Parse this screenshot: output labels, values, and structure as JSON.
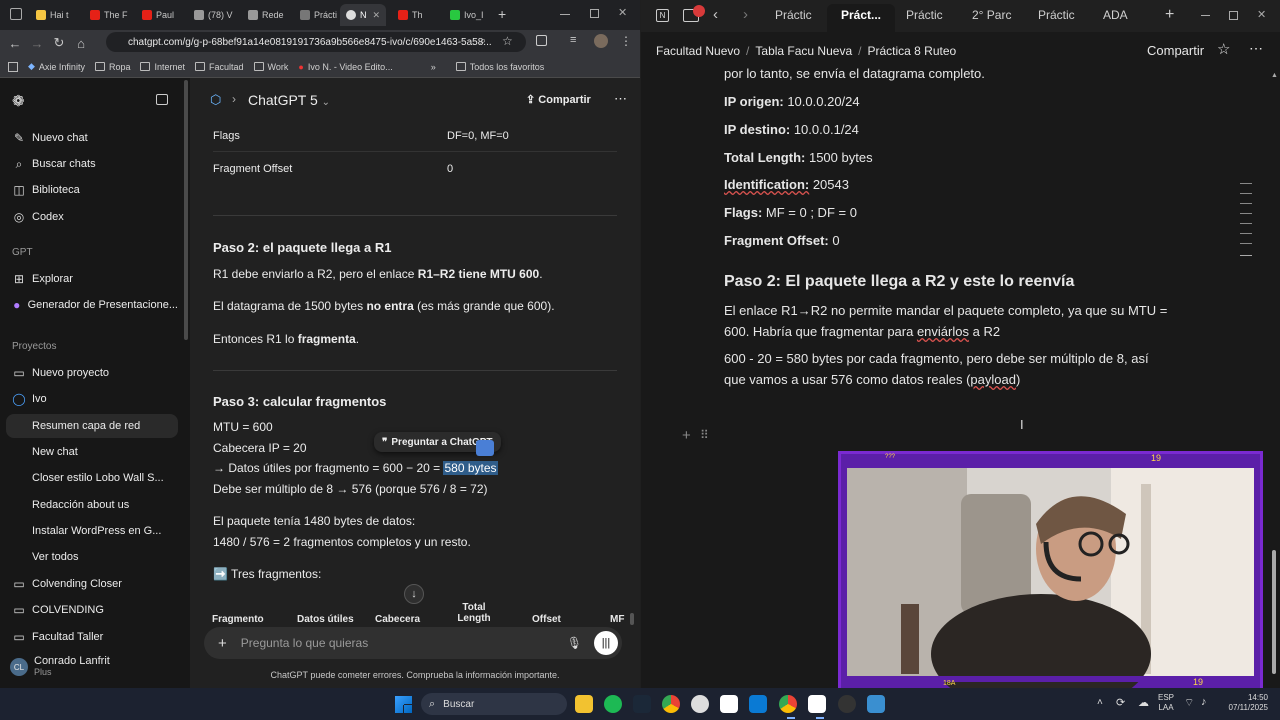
{
  "chrome": {
    "tabs": [
      {
        "label": "Hai t"
      },
      {
        "label": "The F"
      },
      {
        "label": "Paul"
      },
      {
        "label": "(78) V"
      },
      {
        "label": "Rede"
      },
      {
        "label": "Prácti"
      },
      {
        "label": "N"
      },
      {
        "label": "Th"
      },
      {
        "label": "Ivo_I"
      }
    ],
    "new_tab": "+",
    "url": "chatgpt.com/g/g-p-68bef91a14e0819191736a9b566e8475-ivo/c/690e1463-5a58...",
    "bookmarks": [
      {
        "label": "Axie Infinity"
      },
      {
        "label": "Ropa"
      },
      {
        "label": "Internet"
      },
      {
        "label": "Facultad"
      },
      {
        "label": "Work"
      },
      {
        "label": "Ivo N. - Video Edito..."
      }
    ],
    "bookmarks_more": "»",
    "all_bookmarks": "Todos los favoritos"
  },
  "chatgpt": {
    "model_label": "ChatGPT 5",
    "share_label": "Compartir",
    "sidebar": {
      "items": [
        {
          "label": "Nuevo chat",
          "icon": "edit-icon"
        },
        {
          "label": "Buscar chats",
          "icon": "search-icon"
        },
        {
          "label": "Biblioteca",
          "icon": "library-icon"
        },
        {
          "label": "Codex",
          "icon": "codex-icon"
        }
      ],
      "gpt_header": "GPT",
      "gpts": [
        {
          "label": "Explorar"
        },
        {
          "label": "Generador de Presentacione..."
        }
      ],
      "projects_header": "Proyectos",
      "projects": [
        {
          "label": "Nuevo proyecto"
        },
        {
          "label": "Ivo"
        }
      ],
      "chats": [
        {
          "label": "Resumen capa de red"
        },
        {
          "label": "New chat"
        },
        {
          "label": "Closer estilo Lobo Wall S..."
        },
        {
          "label": "Redacción about us"
        },
        {
          "label": "Instalar WordPress en G..."
        },
        {
          "label": "Ver todos"
        }
      ],
      "folders": [
        {
          "label": "Colvending Closer"
        },
        {
          "label": "COLVENDING"
        },
        {
          "label": "Facultad Taller"
        }
      ],
      "user_initials": "CL",
      "user_name": "Conrado Lanfrit",
      "user_plan": "Plus"
    },
    "table_top": {
      "rows": [
        {
          "k": "Flags",
          "v": "DF=0, MF=0"
        },
        {
          "k": "Fragment Offset",
          "v": "0"
        }
      ]
    },
    "step2": {
      "title": "Paso 2: el paquete llega a R1",
      "p1a": "R1 debe enviarlo a R2, pero el enlace ",
      "p1b": "R1–R2 tiene MTU 600",
      "p1c": ".",
      "p2a": "El datagrama de 1500 bytes ",
      "p2b": "no entra",
      "p2c": " (es más grande que 600).",
      "p3a": "Entonces R1 lo ",
      "p3b": "fragmenta",
      "p3c": "."
    },
    "step3": {
      "title": "Paso 3: calcular fragmentos",
      "l1": "MTU = 600",
      "l2": "Cabecera IP = 20",
      "l3a": "→ Datos útiles por fragmento = 600 − 20 = ",
      "l3b": "580 bytes",
      "l4": "Debe ser múltiplo de 8 → 576 (porque 576 / 8 = 72)",
      "l5": "El paquete tenía 1480 bytes de datos:",
      "l6": "1480 / 576 = 2 fragmentos completos y un resto.",
      "l7": "➡️ Tres fragmentos:"
    },
    "ask_popup": "Preguntar a ChatGPT",
    "table_headers": [
      "Fragmento",
      "Datos útiles",
      "Cabecera",
      "Total Length",
      "Offset",
      "MF"
    ],
    "composer_placeholder": "Pregunta lo que quieras",
    "disclaimer": "ChatGPT puede cometer errores. Comprueba la información importante."
  },
  "notion": {
    "tabs": [
      {
        "label": "Práctic"
      },
      {
        "label": "Práct..."
      },
      {
        "label": "Práctic"
      },
      {
        "label": "2° Parc"
      },
      {
        "label": "Práctic"
      },
      {
        "label": "ADA"
      }
    ],
    "breadcrumb": [
      "Facultad Nuevo",
      "Tabla Facu Nueva",
      "Práctica 8 Ruteo"
    ],
    "share_label": "Compartir",
    "lines": {
      "l0": "por lo tanto, se envía el datagrama completo.",
      "ip_origen_k": "IP origen:",
      "ip_origen_v": " 10.0.0.20/24",
      "ip_destino_k": "IP destino:",
      "ip_destino_v": " 10.0.0.1/24",
      "total_k": "Total Length:",
      "total_v": " 1500 bytes",
      "ident_k": "Identification:",
      "ident_v": "  20543",
      "flags_k": "Flags:",
      "flags_v": " MF = 0 ; DF = 0",
      "frag_k": "Fragment Offset:",
      "frag_v": " 0"
    },
    "heading": "Paso 2: El paquete llega a R2 y este lo reenvía",
    "para1a": "El enlace R1→R2 no permite mandar el paquete completo, ya que su MTU =",
    "para1b": "600. Habría que fragmentar para ",
    "para1c": "enviárlos",
    "para1d": " a R2",
    "para2a": "600 - 20 = 580 bytes por cada fragmento, pero debe ser múltiplo de 8, así",
    "para2b": "que vamos a usar 576 como datos reales (",
    "para2c": "payload",
    "para2d": ")"
  },
  "webcam": {
    "top_left": "???",
    "top_right": "19",
    "bottom_mid": "18A",
    "bottom_right": "19"
  },
  "taskbar": {
    "search_label": "Buscar",
    "lang": "ESP",
    "lang2": "LAA",
    "time": "14:50",
    "date": "07/11/2025"
  }
}
